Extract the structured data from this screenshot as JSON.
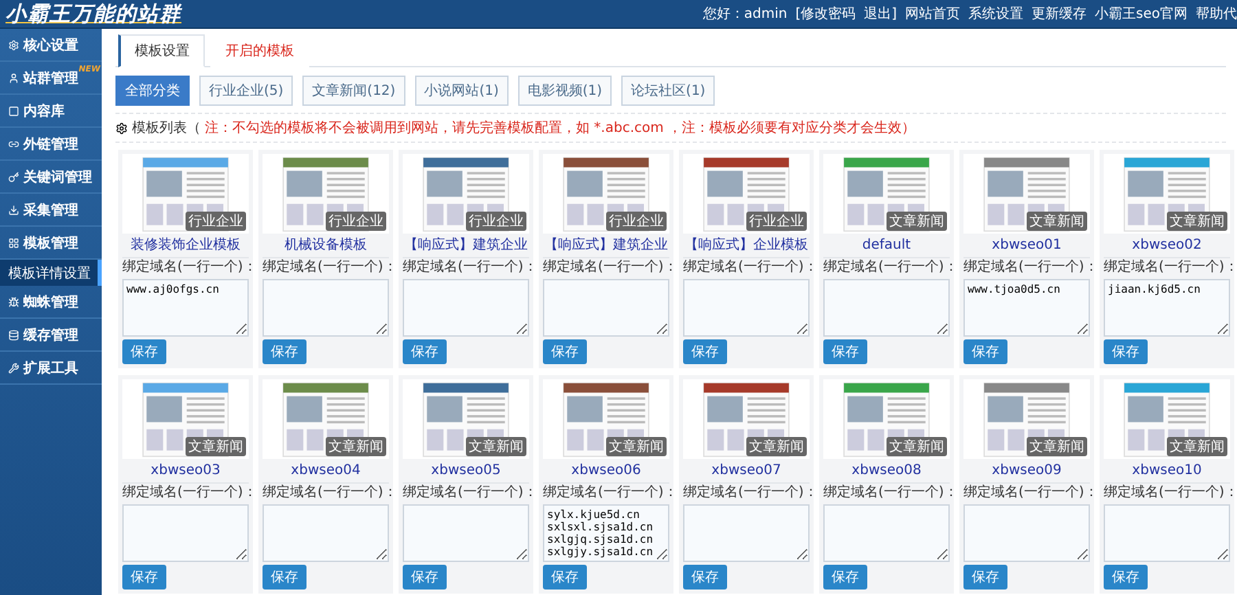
{
  "header": {
    "logo": "小霸王万能的站群",
    "links": [
      "您好：admin",
      "[修改密码",
      "退出]",
      "网站首页",
      "系统设置",
      "更新缓存",
      "小霸王seo官网",
      "帮助代"
    ]
  },
  "sidebar": {
    "items": [
      {
        "label": "核心设置",
        "selected": false
      },
      {
        "label": "站群管理",
        "selected": false,
        "badge": "NEW"
      },
      {
        "label": "内容库",
        "selected": false
      },
      {
        "label": "外链管理",
        "selected": false
      },
      {
        "label": "关键词管理",
        "selected": false
      },
      {
        "label": "采集管理",
        "selected": false
      },
      {
        "label": "模板管理",
        "selected": false,
        "children": [
          {
            "label": "模板详情设置",
            "selected": true
          }
        ]
      },
      {
        "label": "蜘蛛管理",
        "selected": false
      },
      {
        "label": "缓存管理",
        "selected": false
      },
      {
        "label": "扩展工具",
        "selected": false
      }
    ]
  },
  "tabs": [
    {
      "label": "模板设置",
      "selected": true
    },
    {
      "label": "开启的模板",
      "selected": false
    }
  ],
  "filters": [
    {
      "label": "全部分类",
      "selected": true
    },
    {
      "label": "行业企业(5)",
      "selected": false
    },
    {
      "label": "文章新闻(12)",
      "selected": false
    },
    {
      "label": "小说网站(1)",
      "selected": false
    },
    {
      "label": "电影视频(1)",
      "selected": false
    },
    {
      "label": "论坛社区(1)",
      "selected": false
    }
  ],
  "note": {
    "label": "模板列表（",
    "text": "注：不勾选的模板将不会被调用到网站，请先完善模板配置，如 *.abc.com ，注：模板必须要有对应分类才会生效）"
  },
  "templates": [
    {
      "name": "装修装饰企业模板",
      "tag": "行业企业",
      "label": "绑定域名(一行一个)：",
      "domains": "www.aj0ofgs.cn",
      "button": "保存"
    },
    {
      "name": "机械设备模板",
      "tag": "行业企业",
      "label": "绑定域名(一行一个)：",
      "button": "保存"
    },
    {
      "name": "【响应式】建筑企业",
      "tag": "行业企业",
      "label": "绑定域名(一行一个)：",
      "button": "保存"
    },
    {
      "name": "【响应式】建筑企业",
      "tag": "行业企业",
      "label": "绑定域名(一行一个)：",
      "button": "保存"
    },
    {
      "name": "【响应式】企业模板",
      "tag": "行业企业",
      "label": "绑定域名(一行一个)：",
      "button": "保存"
    },
    {
      "name": "default",
      "tag": "文章新闻",
      "label": "绑定域名(一行一个)：",
      "button": "保存"
    },
    {
      "name": "xbwseo01",
      "tag": "文章新闻",
      "label": "绑定域名(一行一个)：",
      "domains": "www.tjoa0d5.cn",
      "button": "保存"
    },
    {
      "name": "xbwseo02",
      "tag": "文章新闻",
      "label": "绑定域名(一行一个)：",
      "domains": "jiaan.kj6d5.cn",
      "button": "保存"
    },
    {
      "name": "xbwseo03",
      "tag": "文章新闻",
      "label": "绑定域名(一行一个)：",
      "button": "保存"
    },
    {
      "name": "xbwseo04",
      "tag": "文章新闻",
      "label": "绑定域名(一行一个)：",
      "button": "保存"
    },
    {
      "name": "xbwseo05",
      "tag": "文章新闻",
      "label": "绑定域名(一行一个)：",
      "button": "保存"
    },
    {
      "name": "xbwseo06",
      "tag": "文章新闻",
      "label": "绑定域名(一行一个)：",
      "domains": "sylx.kjue5d.cn\nsxlsxl.sjsa1d.cn\nsxlgjq.sjsa1d.cn\nsxlgjy.sjsa1d.cn",
      "button": "保存"
    },
    {
      "name": "xbwseo07",
      "tag": "文章新闻",
      "label": "绑定域名(一行一个)：",
      "button": "保存"
    },
    {
      "name": "xbwseo08",
      "tag": "文章新闻",
      "label": "绑定域名(一行一个)：",
      "button": "保存"
    },
    {
      "name": "xbwseo09",
      "tag": "文章新闻",
      "label": "绑定域名(一行一个)：",
      "button": "保存"
    },
    {
      "name": "xbwseo10",
      "tag": "文章新闻",
      "label": "绑定域名(一行一个)：",
      "button": "保存"
    }
  ]
}
